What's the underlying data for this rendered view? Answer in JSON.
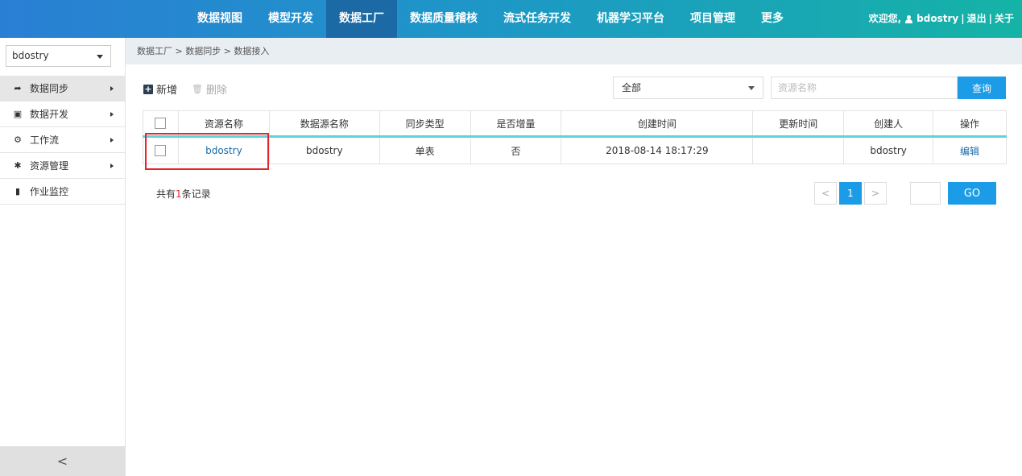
{
  "nav": {
    "items": [
      {
        "label": "数据视图"
      },
      {
        "label": "模型开发"
      },
      {
        "label": "数据工厂"
      },
      {
        "label": "数据质量稽核"
      },
      {
        "label": "流式任务开发"
      },
      {
        "label": "机器学习平台"
      },
      {
        "label": "项目管理"
      },
      {
        "label": "更多"
      }
    ],
    "active_index": 2,
    "welcome": "欢迎您,",
    "username": "bdostry",
    "sep1": "|",
    "logout": "退出",
    "sep2": "|",
    "about": "关于"
  },
  "sidebar": {
    "project": "bdostry",
    "items": [
      {
        "label": "数据同步",
        "icon": "share-arrow-icon",
        "glyph": "➦",
        "active": true
      },
      {
        "label": "数据开发",
        "icon": "code-file-icon",
        "glyph": "▣"
      },
      {
        "label": "工作流",
        "icon": "gears-icon",
        "glyph": "⚙"
      },
      {
        "label": "资源管理",
        "icon": "gear-icon",
        "glyph": "✱"
      },
      {
        "label": "作业监控",
        "icon": "phone-icon",
        "glyph": "▮"
      }
    ],
    "collapse_glyph": "<"
  },
  "breadcrumb": "数据工厂 > 数据同步 > 数据接入",
  "toolbar": {
    "add_label": "新增",
    "delete_label": "删除",
    "filter_value": "全部",
    "search_placeholder": "资源名称",
    "search_button": "查询"
  },
  "table": {
    "headers": [
      "资源名称",
      "数据源名称",
      "同步类型",
      "是否增量",
      "创建时间",
      "更新时间",
      "创建人",
      "操作"
    ],
    "rows": [
      {
        "resource_name": "bdostry",
        "datasource_name": "bdostry",
        "sync_type": "单表",
        "incremental": "否",
        "created_time": "2018-08-14 18:17:29",
        "updated_time": "",
        "creator": "bdostry",
        "action": "编辑"
      }
    ]
  },
  "footer": {
    "total_prefix": "共有",
    "total_count": "1",
    "total_suffix": "条记录",
    "prev": "<",
    "current_page": "1",
    "next": ">",
    "go_label": "GO"
  },
  "colors": {
    "accent": "#1c9ce6",
    "highlight": "#e5262b",
    "header_underline": "#5bd5d9"
  }
}
